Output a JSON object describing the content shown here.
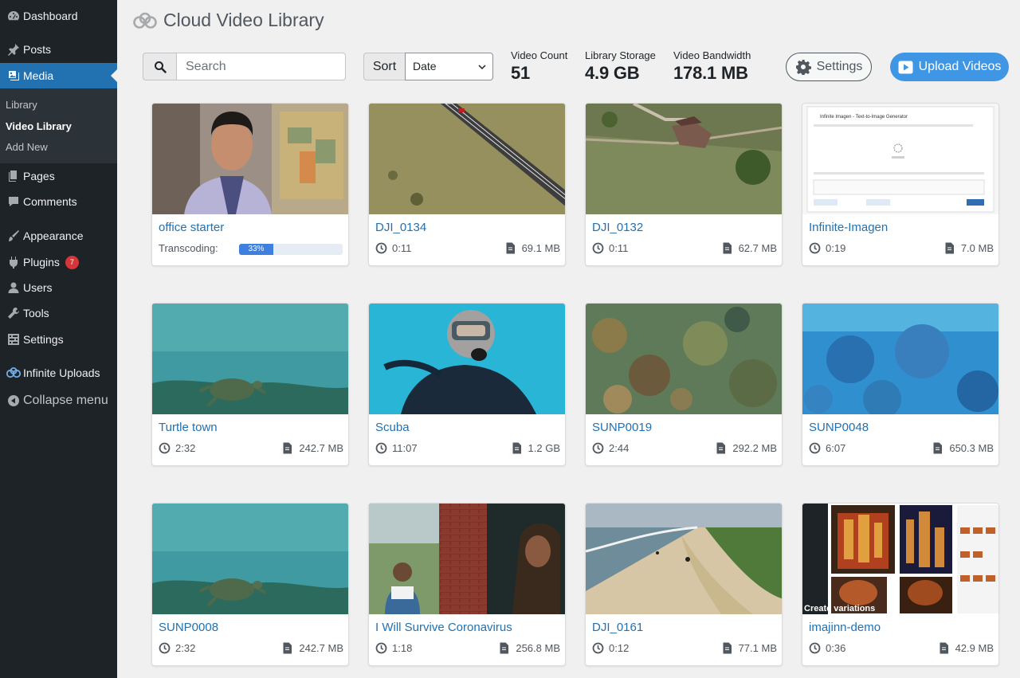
{
  "sidebar": {
    "items": [
      {
        "label": "Dashboard",
        "icon": "dashboard-icon"
      },
      {
        "label": "Posts",
        "icon": "pushpin-icon"
      },
      {
        "label": "Media",
        "icon": "media-icon"
      },
      {
        "label": "Pages",
        "icon": "pages-icon"
      },
      {
        "label": "Comments",
        "icon": "comment-icon"
      },
      {
        "label": "Appearance",
        "icon": "paintbrush-icon"
      },
      {
        "label": "Plugins",
        "icon": "plugin-icon",
        "badge": "7"
      },
      {
        "label": "Users",
        "icon": "user-icon"
      },
      {
        "label": "Tools",
        "icon": "wrench-icon"
      },
      {
        "label": "Settings",
        "icon": "settings-icon"
      },
      {
        "label": "Infinite Uploads",
        "icon": "infinite-uploads-icon"
      }
    ],
    "submenu": [
      {
        "label": "Library"
      },
      {
        "label": "Video Library"
      },
      {
        "label": "Add New"
      }
    ],
    "collapse_label": "Collapse menu"
  },
  "header": {
    "title": "Cloud Video Library"
  },
  "toolbar": {
    "search_placeholder": "Search",
    "sort_label": "Sort",
    "sort_value": "Date",
    "stats": [
      {
        "label": "Video Count",
        "value": "51"
      },
      {
        "label": "Library Storage",
        "value": "4.9 GB"
      },
      {
        "label": "Video Bandwidth",
        "value": "178.1 MB"
      }
    ],
    "settings_label": "Settings",
    "upload_label": "Upload Videos"
  },
  "videos": [
    {
      "title": "office starter",
      "transcoding_label": "Transcoding:",
      "progress": "33%"
    },
    {
      "title": "DJI_0134",
      "duration": "0:11",
      "size": "69.1 MB"
    },
    {
      "title": "DJI_0132",
      "duration": "0:11",
      "size": "62.7 MB"
    },
    {
      "title": "Infinite-Imagen",
      "duration": "0:19",
      "size": "7.0 MB"
    },
    {
      "title": "Turtle town",
      "duration": "2:32",
      "size": "242.7 MB"
    },
    {
      "title": "Scuba",
      "duration": "11:07",
      "size": "1.2 GB"
    },
    {
      "title": "SUNP0019",
      "duration": "2:44",
      "size": "292.2 MB"
    },
    {
      "title": "SUNP0048",
      "duration": "6:07",
      "size": "650.3 MB"
    },
    {
      "title": "SUNP0008",
      "duration": "2:32",
      "size": "242.7 MB"
    },
    {
      "title": "I Will Survive Coronavirus",
      "duration": "1:18",
      "size": "256.8 MB"
    },
    {
      "title": "DJI_0161",
      "duration": "0:12",
      "size": "77.1 MB"
    },
    {
      "title": "imajinn-demo",
      "duration": "0:36",
      "size": "42.9 MB"
    }
  ],
  "thumbnail_text": {
    "imagen_heading": "Infinite Imagen - Text-to-Image Generator",
    "imajinn_caption": "Create variations"
  },
  "colors": {
    "sidebar_bg": "#1d2327",
    "active_menu": "#2271b1",
    "link": "#2271b1",
    "upload_button": "#3e96e4",
    "progress": "#3e7fe0",
    "badge": "#d63638"
  }
}
